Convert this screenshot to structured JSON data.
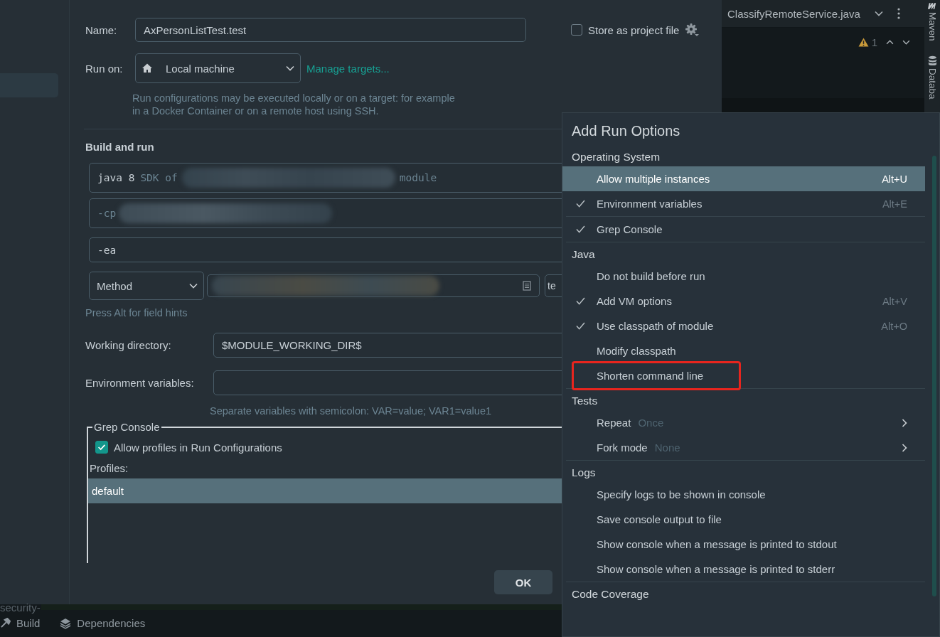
{
  "dialog": {
    "name": {
      "label": "Name:",
      "value": "AxPersonListTest.test"
    },
    "store_as_project_file": {
      "label": "Store as project file",
      "checked": false
    },
    "run_on": {
      "label": "Run on:",
      "value": "Local machine",
      "link": "Manage targets...",
      "hint": "Run configurations may be executed locally or on a target: for example in a Docker Container or on a remote host using SSH."
    },
    "build_and_run": {
      "title": "Build and run",
      "sdk": "java 8",
      "sdk_hint": "SDK of",
      "sdk_suffix": "module",
      "classpath": "-cp",
      "vm_options": "-ea",
      "test_kind": "Method",
      "cut_field": "te",
      "field_hint": "Press Alt for field hints"
    },
    "working_directory": {
      "label": "Working directory:",
      "value": "$MODULE_WORKING_DIR$"
    },
    "environment_variables": {
      "label": "Environment variables:",
      "hint": "Separate variables with semicolon: VAR=value; VAR1=value1"
    },
    "grep_console": {
      "title": "Grep Console",
      "allow_profiles": {
        "label": "Allow profiles in Run Configurations",
        "checked": true
      },
      "profiles_label": "Profiles:",
      "profiles": [
        {
          "name": "default",
          "selected": true
        }
      ]
    },
    "buttons": [
      {
        "label": "OK"
      }
    ]
  },
  "editor": {
    "tab": "ClassifyRemoteService.java",
    "warnings": "1"
  },
  "tool_strip": [
    "Maven",
    "Databa"
  ],
  "bottom": {
    "cut_text": "security-",
    "tools": [
      {
        "label": "Build",
        "kind": "build"
      },
      {
        "label": "Dependencies",
        "kind": "dependencies"
      }
    ]
  },
  "popup": {
    "title": "Add Run Options",
    "groups": [
      {
        "title": "Operating System",
        "items": [
          {
            "label": "Allow multiple instances",
            "checked": false,
            "shortcut": "Alt+U",
            "selected": true,
            "highlighted": false
          },
          {
            "label": "Environment variables",
            "checked": true,
            "shortcut": "Alt+E",
            "selected": false,
            "highlighted": false
          }
        ]
      },
      {
        "items": [
          {
            "label": "Grep Console",
            "checked": true,
            "selected": false,
            "highlighted": false
          }
        ]
      },
      {
        "title": "Java",
        "items": [
          {
            "label": "Do not build before run",
            "checked": false,
            "selected": false,
            "highlighted": false
          },
          {
            "label": "Add VM options",
            "checked": true,
            "shortcut": "Alt+V",
            "selected": false,
            "highlighted": false
          },
          {
            "label": "Use classpath of module",
            "checked": true,
            "shortcut": "Alt+O",
            "selected": false,
            "highlighted": false
          },
          {
            "label": "Modify classpath",
            "checked": false,
            "selected": false,
            "highlighted": false
          },
          {
            "label": "Shorten command line",
            "checked": false,
            "selected": false,
            "highlighted": true
          }
        ]
      },
      {
        "title": "Tests",
        "items": [
          {
            "label": "Repeat",
            "value": "Once",
            "submenu": true,
            "checked": false,
            "selected": false,
            "highlighted": false
          },
          {
            "label": "Fork mode",
            "value": "None",
            "submenu": true,
            "checked": false,
            "selected": false,
            "highlighted": false
          }
        ]
      },
      {
        "title": "Logs",
        "items": [
          {
            "label": "Specify logs to be shown in console",
            "checked": false,
            "selected": false,
            "highlighted": false
          },
          {
            "label": "Save console output to file",
            "checked": false,
            "selected": false,
            "highlighted": false
          },
          {
            "label": "Show console when a message is printed to stdout",
            "checked": false,
            "selected": false,
            "highlighted": false
          },
          {
            "label": "Show console when a message is printed to stderr",
            "checked": false,
            "selected": false,
            "highlighted": false
          }
        ]
      },
      {
        "title": "Code Coverage"
      }
    ]
  }
}
